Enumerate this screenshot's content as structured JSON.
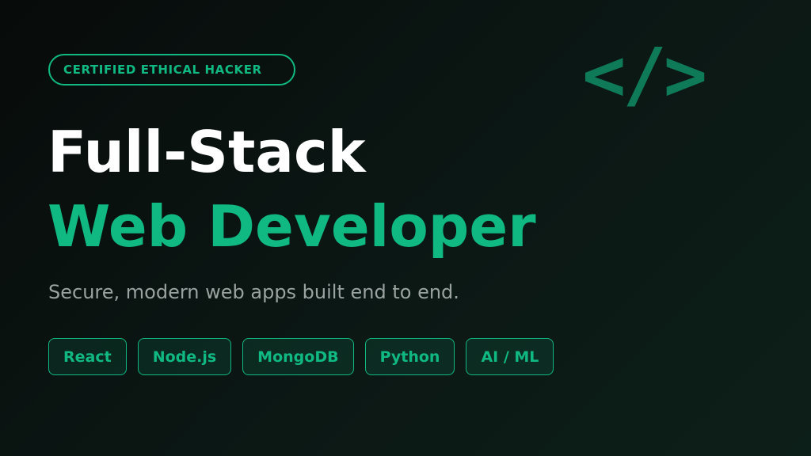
{
  "badge": {
    "label": "CERTIFIED ETHICAL HACKER"
  },
  "icon": {
    "name": "code-icon",
    "glyph": "</>"
  },
  "title": {
    "line1": "Full-Stack",
    "line2": "Web Developer"
  },
  "subtitle": "Secure, modern web apps built end to end.",
  "tags": [
    {
      "label": "React"
    },
    {
      "label": "Node.js"
    },
    {
      "label": "MongoDB"
    },
    {
      "label": "Python"
    },
    {
      "label": "AI / ML"
    }
  ],
  "colors": {
    "accent": "#10b981",
    "icon": "#0e7a57",
    "background": "#0b1613",
    "title": "#ffffff",
    "subtitle": "#9aa3a0"
  }
}
